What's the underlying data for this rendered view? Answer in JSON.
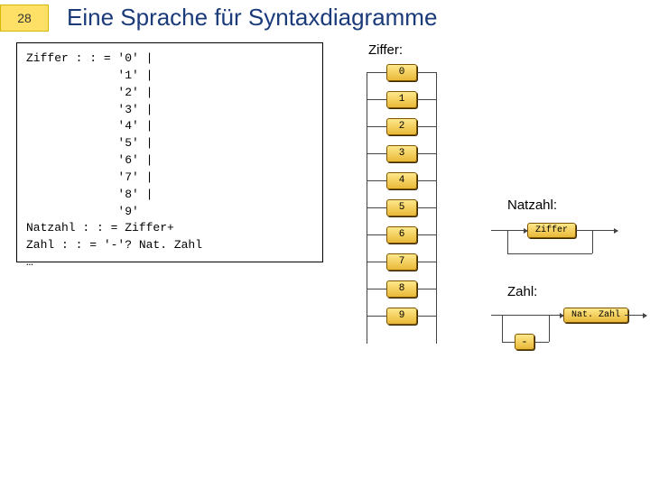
{
  "slide_number": "28",
  "title": "Eine Sprache für Syntaxdiagramme",
  "code": "Ziffer : : = '0' |\n             '1' |\n             '2' |\n             '3' |\n             '4' |\n             '5' |\n             '6' |\n             '7' |\n             '8' |\n             '9'\nNatzahl : : = Ziffer+\nZahl : : = '-'? Nat. Zahl\n…",
  "labels": {
    "ziffer": "Ziffer:",
    "natzahl": "Natzahl:",
    "zahl": "Zahl:"
  },
  "digits": [
    "0",
    "1",
    "2",
    "3",
    "4",
    "5",
    "6",
    "7",
    "8",
    "9"
  ],
  "natzahl_node": "Ziffer",
  "zahl_nodes": {
    "nat": "Nat. Zahl",
    "minus": "-"
  }
}
